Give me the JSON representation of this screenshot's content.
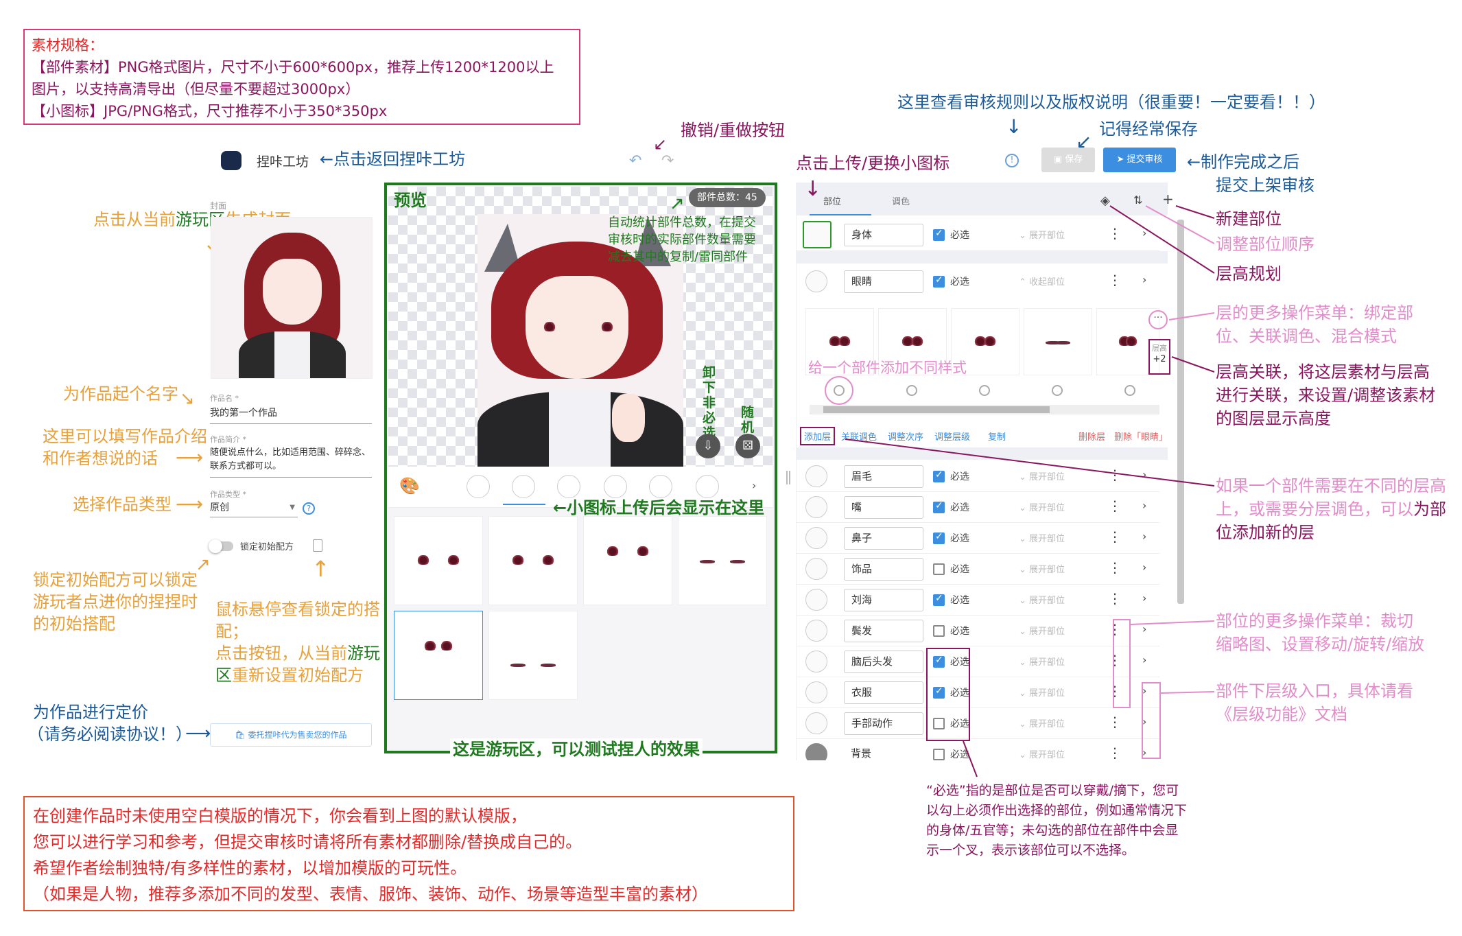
{
  "spec": {
    "title": "素材规格：",
    "line1": "【部件素材】PNG格式图片，尺寸不小于600*600px，推荐上传1200*1200以上",
    "line2": "图片，以支持高清导出（但尽量不要超过3000px）",
    "line3": "【小图标】JPG/PNG格式，尺寸推荐不小于350*350px"
  },
  "header": {
    "app_name": "捏咔工坊",
    "save": "保存",
    "submit": "提交审核"
  },
  "left": {
    "cover_label": "封面",
    "name_label": "作品名 *",
    "name_value": "我的第一个作品",
    "desc_label": "作品简介 *",
    "desc_value": "随便说点什么，比如适用范围、碎碎念、联系方式都可以。",
    "type_label": "作品类型 *",
    "type_value": "原创",
    "lock_label": "锁定初始配方",
    "entrust_button": "委托捏咔代为售卖您的作品"
  },
  "preview": {
    "label": "预览",
    "count_badge": "部件总数：45",
    "unselect": "卸下非必选",
    "random": "随机"
  },
  "panel": {
    "tab_parts": "部位",
    "tab_color": "调色",
    "collapse": "收起部位",
    "expand": "展开部位",
    "required": "必选",
    "layer_height_label": "层高",
    "layer_height_value": "+2",
    "actions": [
      "添加层",
      "关联调色",
      "调整次序",
      "调整层级",
      "复制"
    ],
    "delete_layer": "删除层",
    "delete_part": "删除「眼睛」",
    "rows": [
      {
        "name": "身体",
        "checked": true
      },
      {
        "name": "眼睛",
        "checked": true
      },
      {
        "name": "眉毛",
        "checked": true
      },
      {
        "name": "嘴",
        "checked": true
      },
      {
        "name": "鼻子",
        "checked": true
      },
      {
        "name": "饰品",
        "checked": false
      },
      {
        "name": "刘海",
        "checked": true
      },
      {
        "name": "鬓发",
        "checked": false
      },
      {
        "name": "脑后头发",
        "checked": true
      },
      {
        "name": "衣服",
        "checked": true
      },
      {
        "name": "手部动作",
        "checked": false
      },
      {
        "name": "背景",
        "checked": false
      }
    ]
  },
  "annotations": {
    "back": "←点击返回捏咔工坊",
    "undo": "撤销/重做按钮",
    "rules": "这里查看审核规则以及版权说明（很重要！一定要看！！）",
    "save_often": "记得经常保存",
    "upload_icon": "点击上传/更换小图标",
    "submit_1": "←制作完成之后",
    "submit_2": "提交上架审核",
    "new_part": "新建部位",
    "reorder": "调整部位顺序",
    "layer_plan": "层高规划",
    "layer_menu_1": "层的更多操作菜单：绑定部",
    "layer_menu_2": "位、关联调色、混合模式",
    "layer_link_1": "层高关联，将这层素材与层高",
    "layer_link_2": "进行关联，来设置/调整该素材",
    "layer_link_3": "的图层显示高度",
    "add_style": "给一个部件添加不同样式",
    "add_layer_1": "如果一个部件需要在不同的层高",
    "add_layer_2a": "上，或需要分层调色，可以",
    "add_layer_2b": "为部",
    "add_layer_3": "位添加新的层",
    "part_menu_1": "部位的更多操作菜单：裁切",
    "part_menu_2": "缩略图、设置移动/旋转/缩放",
    "sublevel_1": "部件下层级入口，具体请看",
    "sublevel_2": "《层级功能》文档",
    "required_1": "“必选”指的是部位是否可以穿戴/摘下，您可",
    "required_2": "以勾上必须作出选择的部位，例如通常情况下",
    "required_3": "的身体/五官等；未勾选的部位在部件中会显",
    "required_4": "示一个叉，表示该部位可以不选择。",
    "cover_a": "点击从当前",
    "cover_b": "游玩区",
    "cover_c": "生成封面",
    "name_hint": "为作品起个名字",
    "desc_1": "这里可以填写作品介绍",
    "desc_2": "和作者想说的话",
    "type_hint": "选择作品类型",
    "lock_1": "锁定初始配方可以锁定",
    "lock_2": "游玩者点进你的捏捏时",
    "lock_3": "的初始搭配",
    "hover_1": "鼠标悬停查看锁定的搭",
    "hover_2": "配；",
    "hover_3a": "点击按钮，从当前",
    "hover_3b": "游玩",
    "hover_4a": "区",
    "hover_4b": "重新设置初始配方",
    "price_1": "为作品进行定价",
    "price_2": "（请务必阅读协议！）",
    "auto_count_1": "自动统计部件总数，在提交",
    "auto_count_2": "审核时的实际部件数量需要",
    "auto_count_3": "减去其中的复制/雷同部件",
    "icon_shown": "←小图标上传后会显示在这里",
    "play_area": "这是游玩区，可以测试捏人的效果",
    "bottom_1": "在创建作品时未使用空白模版的情况下，你会看到上图的默认模版，",
    "bottom_2": "您可以进行学习和参考，但提交审核时请将所有素材都删除/替换成自己的。",
    "bottom_3": "希望作者绘制独特/有多样性的素材，以增加模版的可玩性。",
    "bottom_4": "（如果是人物，推荐多添加不同的发型、表情、服饰、装饰、动作、场景等造型丰富的素材）"
  },
  "colors": {
    "accent": "#3b8ee0",
    "green": "#1f7a1f",
    "purple": "#8a1660",
    "pink": "#e38ccb",
    "orange": "#e8a13a",
    "red": "#e32a2a"
  }
}
